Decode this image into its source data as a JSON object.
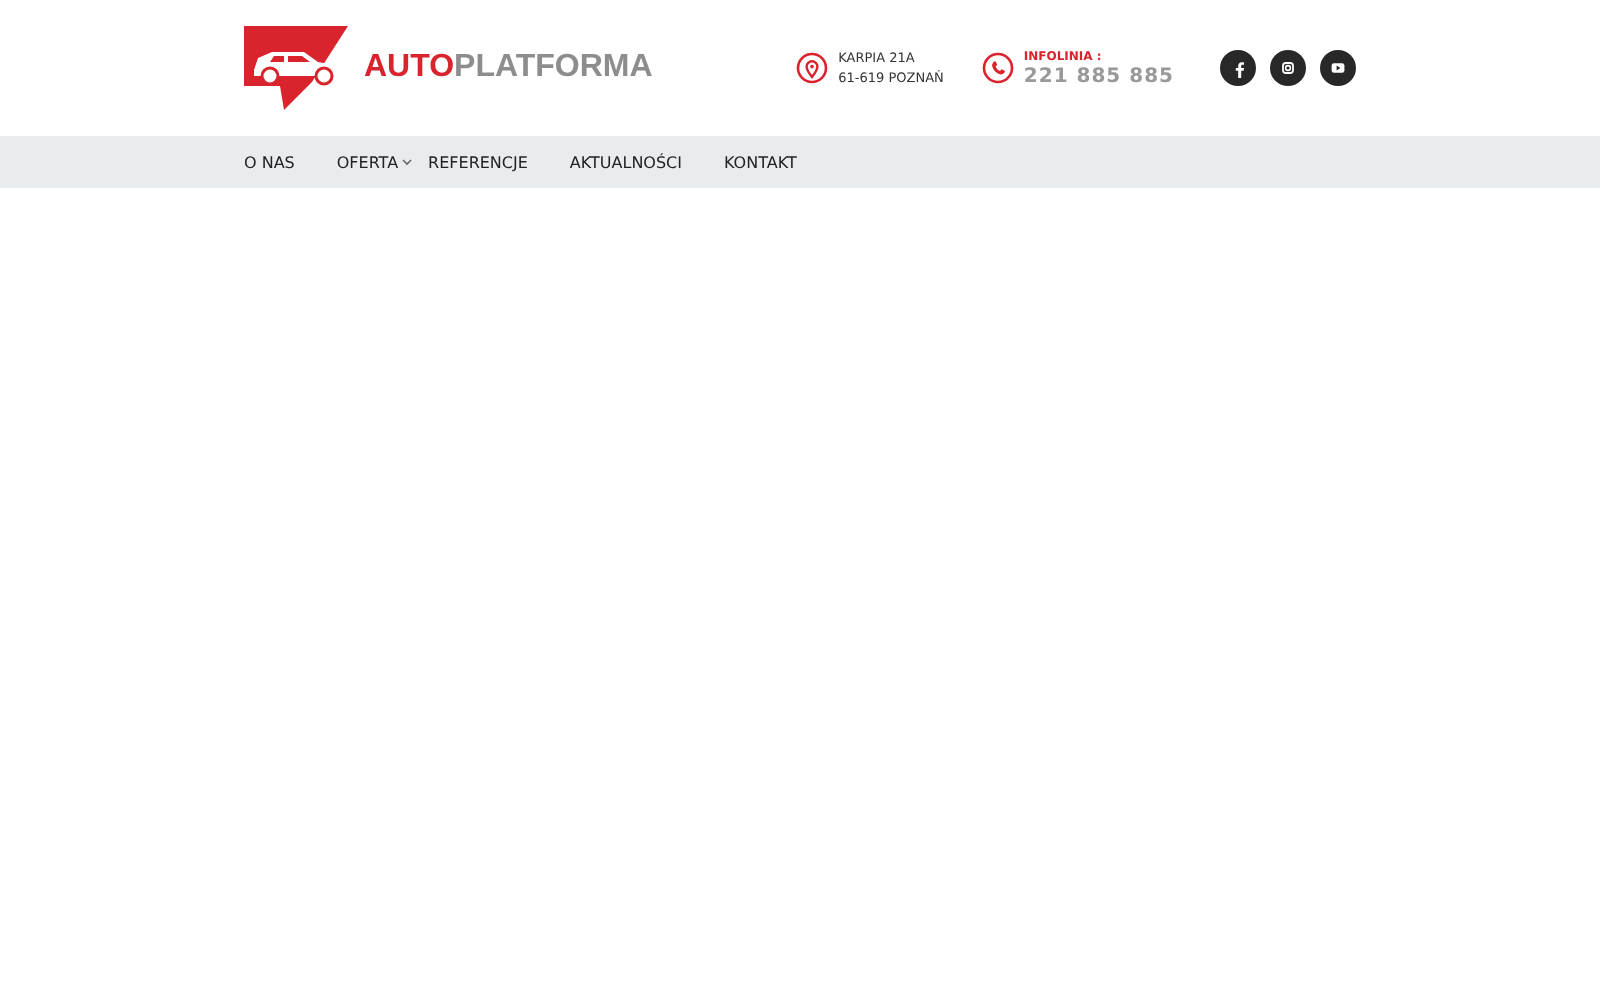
{
  "logo": {
    "primary": "AUTO",
    "secondary": "PLATFORMA"
  },
  "address": {
    "lines": [
      "KARPIA 21A",
      "61-619 POZNAŃ"
    ]
  },
  "hotline": {
    "label": "INFOLINIA :",
    "number": "221 885 885"
  },
  "social": [
    {
      "kind": "facebook"
    },
    {
      "kind": "instagram"
    },
    {
      "kind": "youtube"
    }
  ],
  "nav": [
    {
      "label": "O NAS",
      "has_submenu": false
    },
    {
      "label": "OFERTA",
      "has_submenu": true
    },
    {
      "label": "REFERENCJE",
      "has_submenu": false
    },
    {
      "label": "AKTUALNOŚCI",
      "has_submenu": false
    },
    {
      "label": "KONTAKT",
      "has_submenu": false
    }
  ]
}
